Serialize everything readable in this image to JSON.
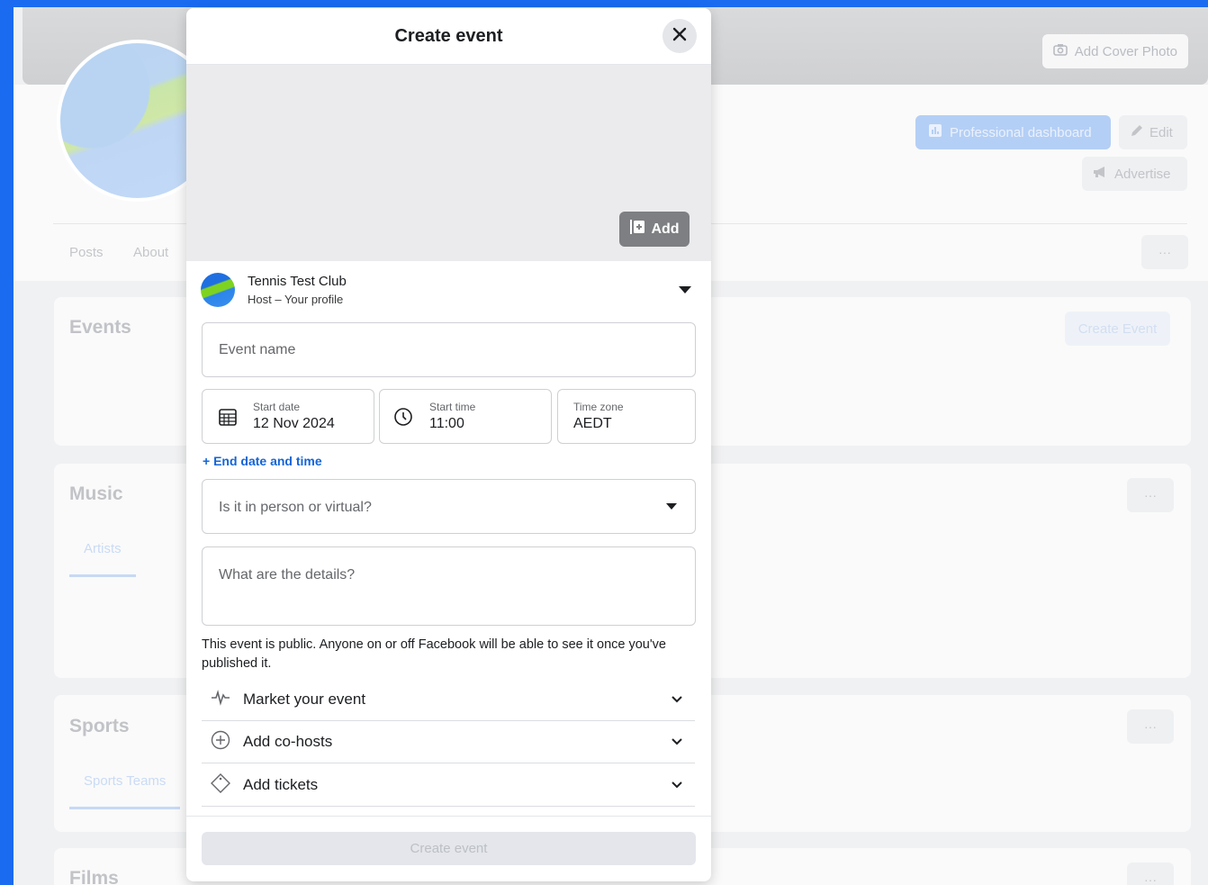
{
  "background": {
    "cover_photo_label": "Add Cover Photo",
    "professional_dashboard_label": "Professional dashboard",
    "edit_label": "Edit",
    "advertise_label": "Advertise",
    "tabs": [
      "Posts",
      "About"
    ],
    "more_label": "···",
    "cards": [
      {
        "title": "Events",
        "action": "Create Event"
      },
      {
        "title": "Music",
        "tab": "Artists"
      },
      {
        "title": "Sports",
        "tab": "Sports Teams"
      },
      {
        "title": "Films"
      }
    ]
  },
  "modal": {
    "title": "Create event",
    "add_photo_label": "Add",
    "host": {
      "name": "Tennis Test Club",
      "subtitle": "Host – Your profile"
    },
    "event_name_placeholder": "Event name",
    "start_date": {
      "label": "Start date",
      "value": "12 Nov 2024"
    },
    "start_time": {
      "label": "Start time",
      "value": "11:00"
    },
    "time_zone": {
      "label": "Time zone",
      "value": "AEDT"
    },
    "end_date_link": "+ End date and time",
    "location_type_placeholder": "Is it in person or virtual?",
    "details_placeholder": "What are the details?",
    "public_notice": "This event is public. Anyone on or off Facebook will be able to see it once you've published it.",
    "sections": [
      {
        "label": "Market your event",
        "icon": "activity-icon"
      },
      {
        "label": "Add co-hosts",
        "icon": "plus-circle-icon"
      },
      {
        "label": "Add tickets",
        "icon": "ticket-icon"
      }
    ],
    "submit_label": "Create event"
  },
  "colors": {
    "accent": "#1465d6",
    "frame": "#1a6bf0"
  }
}
